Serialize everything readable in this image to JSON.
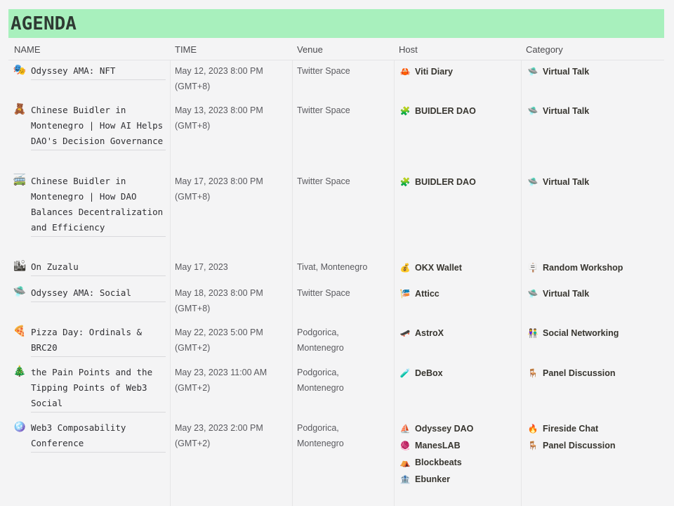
{
  "title": "AGENDA",
  "headers": {
    "name": "NAME",
    "time": "TIME",
    "venue": "Venue",
    "host": "Host",
    "category": "Category"
  },
  "rows": [
    {
      "icon": "🎭",
      "name": "Odyssey AMA: NFT",
      "time1": "May 12, 2023 8:00 PM",
      "time2": "(GMT+8)",
      "venue1": "Twitter Space",
      "venue2": "",
      "hosts": [
        {
          "icon": "🦀",
          "label": "Viti Diary"
        }
      ],
      "categories": [
        {
          "icon": "🛸",
          "label": "Virtual Talk"
        }
      ]
    },
    {
      "icon": "🧸",
      "name": "Chinese Buidler in Montenegro | How AI Helps DAO's Decision Governance",
      "time1": "May 13, 2023 8:00 PM",
      "time2": "(GMT+8)",
      "venue1": "Twitter Space",
      "venue2": "",
      "hosts": [
        {
          "icon": "🧩",
          "label": "BUIDLER DAO"
        }
      ],
      "categories": [
        {
          "icon": "🛸",
          "label": "Virtual Talk"
        }
      ]
    },
    {
      "icon": "🚎",
      "name": "Chinese Buidler in Montenegro | How DAO Balances Decentralization and Efficiency",
      "time1": "May 17, 2023 8:00 PM",
      "time2": "(GMT+8)",
      "venue1": "Twitter Space",
      "venue2": "",
      "hosts": [
        {
          "icon": "🧩",
          "label": "BUIDLER DAO"
        }
      ],
      "categories": [
        {
          "icon": "🛸",
          "label": "Virtual Talk"
        }
      ]
    },
    {
      "icon": "🏙",
      "name": "On Zuzalu",
      "time1": "May 17, 2023",
      "time2": "",
      "venue1": "Tivat, Montenegro",
      "venue2": "",
      "hosts": [
        {
          "icon": "💰",
          "label": "OKX Wallet"
        }
      ],
      "categories": [
        {
          "icon": "🪧",
          "label": "Random Workshop"
        }
      ]
    },
    {
      "icon": "🛸",
      "name": "Odyssey AMA: Social",
      "time1": "May 18, 2023 8:00 PM",
      "time2": "(GMT+8)",
      "venue1": "Twitter Space",
      "venue2": "",
      "hosts": [
        {
          "icon": "🎏",
          "label": "Atticc"
        }
      ],
      "categories": [
        {
          "icon": "🛸",
          "label": "Virtual Talk"
        }
      ]
    },
    {
      "icon": "🍕",
      "name": "Pizza Day: Ordinals & BRC20",
      "time1": "May 22, 2023 5:00 PM",
      "time2": "(GMT+2)",
      "venue1": "Podgorica,",
      "venue2": "Montenegro",
      "hosts": [
        {
          "icon": "🛹",
          "label": "AstroX"
        }
      ],
      "categories": [
        {
          "icon": "👫",
          "label": "Social Networking"
        }
      ]
    },
    {
      "icon": "🎄",
      "name": "the Pain Points and the Tipping Points of Web3 Social",
      "time1": "May 23, 2023 11:00 AM",
      "time2": "(GMT+2)",
      "venue1": "Podgorica,",
      "venue2": "Montenegro",
      "hosts": [
        {
          "icon": "🧪",
          "label": "DeBox"
        }
      ],
      "categories": [
        {
          "icon": "🪑",
          "label": "Panel Discussion"
        }
      ]
    },
    {
      "icon": "🪩",
      "name": "Web3 Composability Conference",
      "time1": "May 23, 2023 2:00 PM",
      "time2": "(GMT+2)",
      "venue1": "Podgorica,",
      "venue2": "Montenegro",
      "hosts": [
        {
          "icon": "⛵",
          "label": "Odyssey DAO"
        },
        {
          "icon": "🧶",
          "label": "ManesLAB"
        },
        {
          "icon": "⛺",
          "label": "Blockbeats"
        },
        {
          "icon": "🏦",
          "label": "Ebunker"
        }
      ],
      "categories": [
        {
          "icon": "🔥",
          "label": "Fireside Chat"
        },
        {
          "icon": "🪑",
          "label": "Panel Discussion"
        }
      ]
    }
  ]
}
